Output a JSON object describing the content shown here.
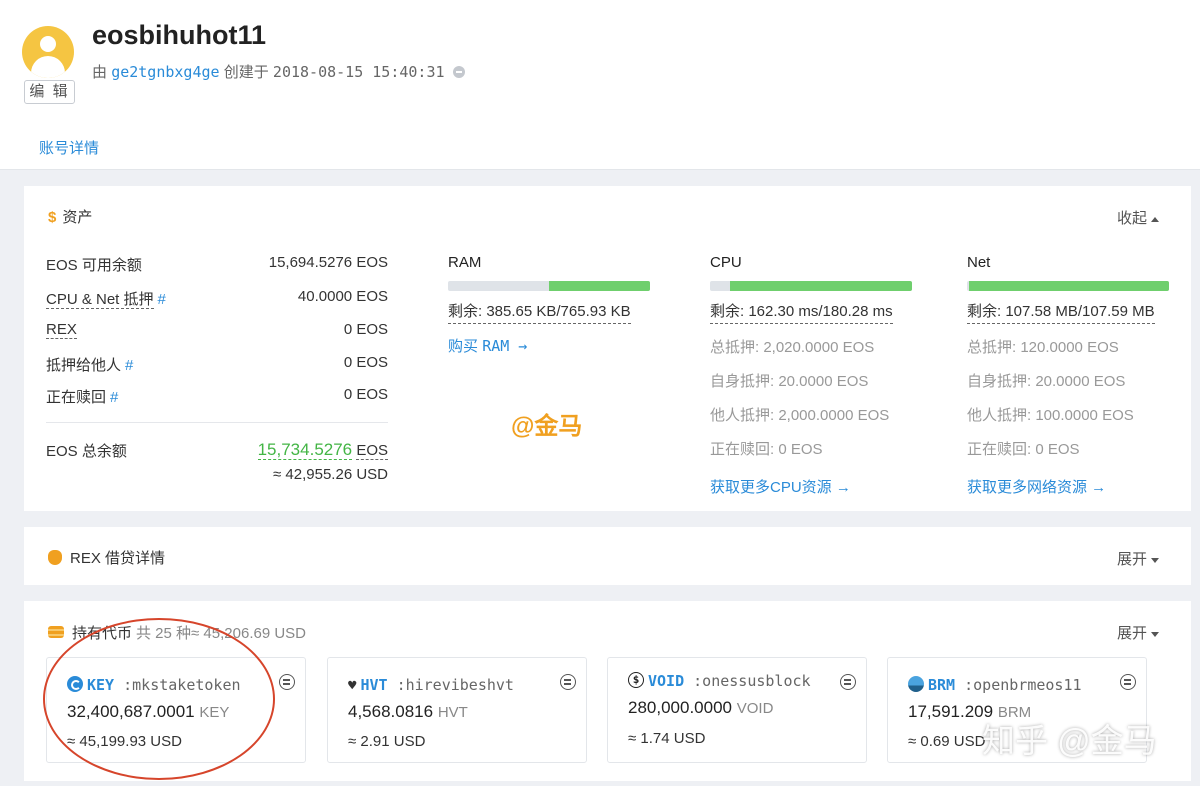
{
  "account": {
    "name": "eosbihuhot11",
    "created_by_prefix": "由",
    "creator": "ge2tgnbxg4ge",
    "created_label": "创建于",
    "created_at": "2018-08-15 15:40:31",
    "edit_label": "编 辑"
  },
  "tabs": {
    "detail": "账号详情"
  },
  "assets": {
    "title": "资产",
    "toggle": "收起",
    "rows": [
      {
        "label": "EOS 可用余额",
        "value": "15,694.5276 EOS"
      },
      {
        "label": "CPU & Net 抵押",
        "value": "40.0000 EOS"
      },
      {
        "label": "REX",
        "value": "0 EOS"
      },
      {
        "label": "抵押给他人",
        "value": "0 EOS"
      },
      {
        "label": "正在赎回",
        "value": "0 EOS"
      }
    ],
    "hash": "#",
    "total_label": "EOS 总余额",
    "total_value": "15,734.5276",
    "total_unit": "EOS",
    "total_usd": "≈ 42,955.26 USD"
  },
  "resources": {
    "ram": {
      "title": "RAM",
      "used_fraction": 0.5,
      "remain": "剩余: 385.65 KB/765.93 KB",
      "buy_label": "购买",
      "buy_mono": "RAM →"
    },
    "cpu": {
      "title": "CPU",
      "used_fraction": 0.9,
      "remain": "剩余: 162.30 ms/180.28 ms",
      "details": [
        "总抵押: 2,020.0000 EOS",
        "自身抵押: 20.0000 EOS",
        "他人抵押: 2,000.0000 EOS",
        "正在赎回: 0 EOS"
      ],
      "more": "获取更多CPU资源 →"
    },
    "net": {
      "title": "Net",
      "used_fraction": 0.99,
      "remain": "剩余: 107.58 MB/107.59 MB",
      "details": [
        "总抵押: 120.0000 EOS",
        "自身抵押: 20.0000 EOS",
        "他人抵押: 100.0000 EOS",
        "正在赎回: 0 EOS"
      ],
      "more": "获取更多网络资源 →"
    }
  },
  "watermark_mid": "@金马",
  "rex": {
    "title": "REX 借贷详情",
    "toggle": "展开"
  },
  "tokens": {
    "title": "持有代币",
    "count": "共 25 种≈ 45,206.69 USD",
    "toggle": "展开",
    "items": [
      {
        "symbol": "KEY",
        "contract": ":mkstaketoken",
        "amount": "32,400,687.0001",
        "unit": "KEY",
        "usd": "≈ 45,199.93 USD",
        "icon": "key-token-icon"
      },
      {
        "symbol": "HVT",
        "contract": ":hirevibeshvt",
        "amount": "4,568.0816",
        "unit": "HVT",
        "usd": "≈ 2.91 USD",
        "icon": "hvt-token-icon"
      },
      {
        "symbol": "VOID",
        "contract": ":onessusblock",
        "amount": "280,000.0000",
        "unit": "VOID",
        "usd": "≈ 1.74 USD",
        "icon": "void-token-icon"
      },
      {
        "symbol": "BRM",
        "contract": ":openbrmeos11",
        "amount": "17,591.209",
        "unit": "BRM",
        "usd": "≈ 0.69 USD",
        "icon": "brm-token-icon"
      }
    ]
  },
  "watermark": "知乎 @金马",
  "colors": {
    "link": "#2a8bd8",
    "green": "#43b545",
    "accent": "#f0a020",
    "highlight_circle": "#d6452b"
  }
}
